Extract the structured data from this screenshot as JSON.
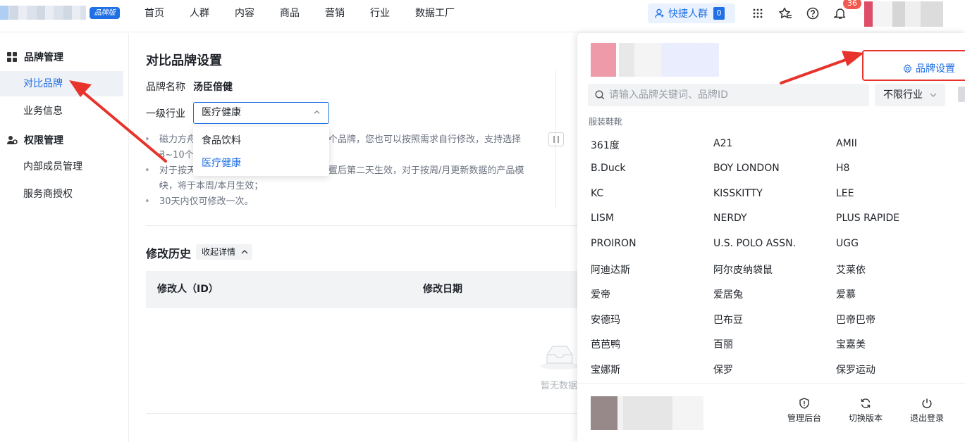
{
  "topbar": {
    "brand_tag": "品牌版",
    "nav": [
      "首页",
      "人群",
      "内容",
      "商品",
      "营销",
      "行业",
      "数据工厂"
    ],
    "quick_people": "快捷人群",
    "quick_count": "0",
    "notif_count": "36"
  },
  "sidebar": {
    "group1": "品牌管理",
    "items1": [
      "对比品牌",
      "业务信息"
    ],
    "group2": "权限管理",
    "items2": [
      "内部成员管理",
      "服务商授权"
    ]
  },
  "main": {
    "title": "对比品牌设置",
    "brand_name_label": "品牌名称",
    "brand_name_value": "汤臣倍健",
    "industry_label": "一级行业",
    "industry_value": "医疗健康",
    "industry_options": [
      "食品饮料",
      "医疗健康"
    ],
    "notes": [
      "磁力方舟",
      "个品牌，您也可以按照需求自行修改，支持选择",
      "3~10个",
      "对于按天",
      "置后第二天生效，对于按周/月更新数据的产品模",
      "块，将于本周/本月生效；",
      "30天内仅可修改一次。"
    ],
    "history_title": "修改历史",
    "collapse_label": "收起详情",
    "col_modifier": "修改人（ID）",
    "col_date": "修改日期",
    "empty_text": "暂无数据"
  },
  "panel": {
    "brand_settings": "品牌设置",
    "search_placeholder": "请输入品牌关键词、品牌ID",
    "industry_filter": "不限行业",
    "category": "服装鞋靴",
    "brands": [
      "361度",
      "A21",
      "AMII",
      "B.Duck",
      "BOY LONDON",
      "H8",
      "KC",
      "KISSKITTY",
      "LEE",
      "LISM",
      "NERDY",
      "PLUS RAPIDE",
      "PROIRON",
      "U.S. POLO ASSN.",
      "UGG",
      "阿迪达斯",
      "阿尔皮纳袋鼠",
      "艾莱依",
      "爱帝",
      "爱居兔",
      "爱慕",
      "安德玛",
      "巴布豆",
      "巴帝巴帝",
      "芭芭鸭",
      "百丽",
      "宝嘉美",
      "宝娜斯",
      "保罗",
      "保罗运动"
    ],
    "footer": [
      "管理后台",
      "切换版本",
      "退出登录"
    ]
  },
  "colors": {
    "accent": "#1f6fe5",
    "highlight_red": "#e7332b",
    "badge": "#f25a4f"
  }
}
